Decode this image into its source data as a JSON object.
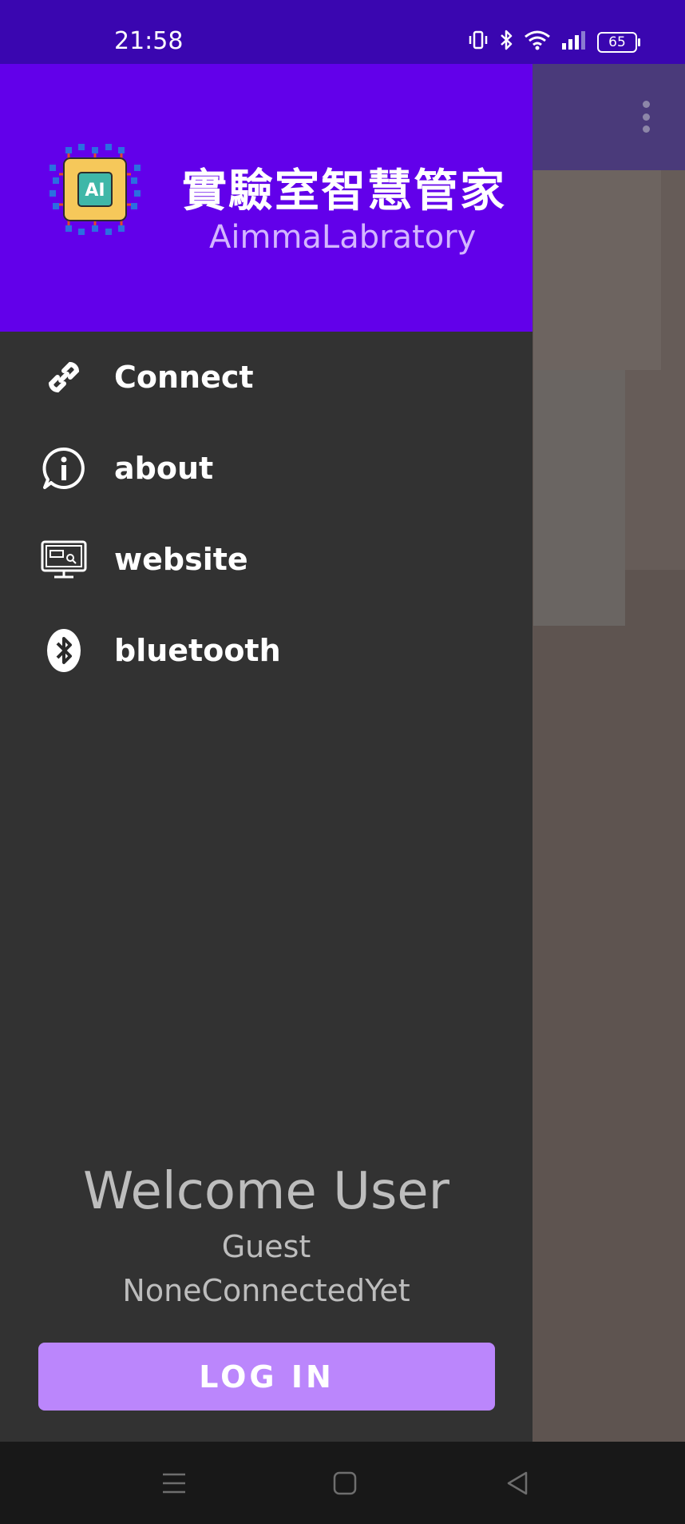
{
  "status_bar": {
    "time": "21:58",
    "battery": "65",
    "icons": [
      "vibrate-icon",
      "bluetooth-icon",
      "wifi-icon",
      "signal-icon",
      "battery-icon"
    ]
  },
  "drawer": {
    "header": {
      "title": "實驗室智慧管家",
      "subtitle": "AimmaLabratory",
      "logo_text": "AI"
    },
    "menu": [
      {
        "label": "Connect",
        "icon": "link-icon"
      },
      {
        "label": "about",
        "icon": "info-icon"
      },
      {
        "label": "website",
        "icon": "monitor-icon"
      },
      {
        "label": "bluetooth",
        "icon": "bluetooth-icon"
      }
    ],
    "welcome": {
      "title": "Welcome User",
      "name": "Guest",
      "status": "NoneConnectedYet"
    },
    "login_label": "LOG IN"
  },
  "navigation_bar": {
    "icons": [
      "menu-icon",
      "home-icon",
      "back-icon"
    ]
  },
  "colors": {
    "status_bar": "#3a06b0",
    "drawer_header": "#6200ea",
    "drawer_body": "#323232",
    "accent_button": "#bb86fc",
    "subtitle": "#d4b6ff"
  }
}
